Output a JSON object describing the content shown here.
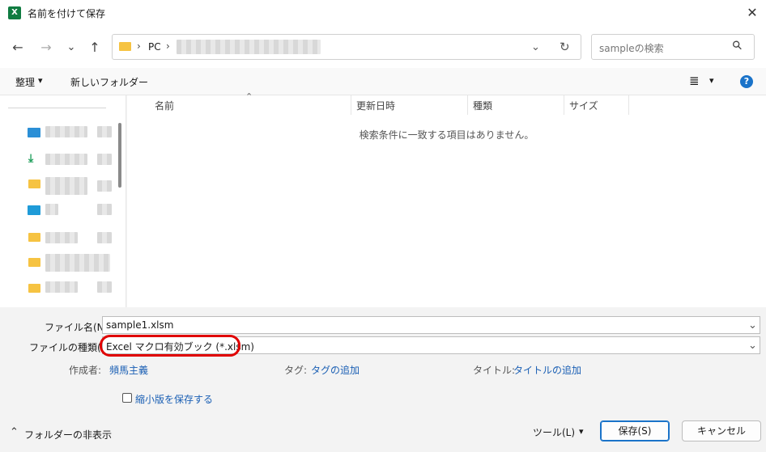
{
  "window": {
    "app_icon": "X",
    "title": "名前を付けて保存",
    "close_glyph": "✕"
  },
  "nav": {
    "back_glyph": "←",
    "forward_glyph": "→",
    "recent_glyph": "⌄",
    "up_glyph": "↑"
  },
  "address": {
    "crumb_sep": "›",
    "crumb_pc": "PC",
    "dropdown_glyph": "⌄",
    "refresh_glyph": "↻"
  },
  "search": {
    "placeholder": "sampleの検索",
    "icon_glyph": "⚲"
  },
  "toolbar": {
    "organize_label": "整理",
    "organize_caret": "▾",
    "new_folder_label": "新しいフォルダー",
    "view_glyph": "≣",
    "view_caret": "▾",
    "help_glyph": "?"
  },
  "file_list": {
    "sort_indicator": "⌃",
    "columns": [
      "名前",
      "更新日時",
      "種類",
      "サイズ"
    ],
    "empty_message": "検索条件に一致する項目はありません。"
  },
  "form": {
    "filename_label": "ファイル名(N):",
    "filename_value": "sample1.xlsm",
    "filetype_label": "ファイルの種類(T):",
    "filetype_value": "Excel マクロ有効ブック (*.xlsm)",
    "dropdown_glyph": "⌄",
    "author_label": "作成者:",
    "author_value": "頻馬主義",
    "tags_label": "タグ:",
    "tags_value": "タグの追加",
    "title_label": "タイトル:",
    "title_value": "タイトルの追加",
    "thumbnail_label": "縮小版を保存する"
  },
  "footer": {
    "hide_folders_glyph": "⌃",
    "hide_folders_label": "フォルダーの非表示",
    "tools_label": "ツール(L)",
    "tools_caret": "▾",
    "save_label": "保存(S)",
    "cancel_label": "キャンセル"
  },
  "colors": {
    "accent": "#1a73c9",
    "highlight_ring": "#e00000",
    "excel_green": "#107c41",
    "folder": "#f6c342"
  }
}
